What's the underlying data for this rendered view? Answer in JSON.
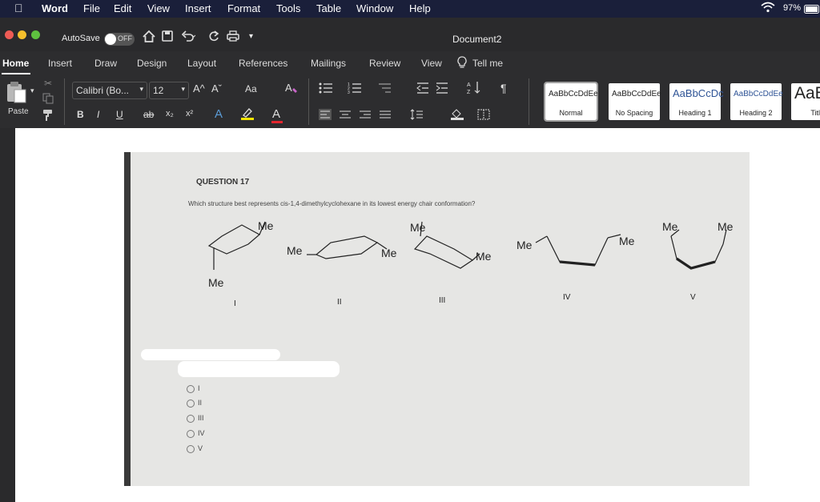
{
  "menubar": {
    "apple": "",
    "app_name": "Word",
    "items": [
      "File",
      "Edit",
      "View",
      "Insert",
      "Format",
      "Tools",
      "Table",
      "Window",
      "Help"
    ],
    "battery": "97%"
  },
  "window": {
    "autosave_label": "AutoSave",
    "autosave_state": "OFF",
    "title": "Document2"
  },
  "ribbon_tabs": [
    "Home",
    "Insert",
    "Draw",
    "Design",
    "Layout",
    "References",
    "Mailings",
    "Review",
    "View"
  ],
  "tell_me": "Tell me",
  "ribbon": {
    "paste": "Paste",
    "font_name": "Calibri (Bo...",
    "font_size": "12",
    "bold": "B",
    "italic": "I",
    "underline": "U",
    "strike": "ab",
    "subscript": "x₂",
    "superscript": "x²",
    "font_color_glyph": "A",
    "case_glyph": "Aa",
    "grow": "A^",
    "shrink": "Aˇ"
  },
  "styles": [
    {
      "preview": "AaBbCcDdEe",
      "name": "Normal",
      "color": "#222222"
    },
    {
      "preview": "AaBbCcDdEe",
      "name": "No Spacing",
      "color": "#222222"
    },
    {
      "preview": "AaBbCcDc",
      "name": "Heading 1",
      "color": "#2f5496"
    },
    {
      "preview": "AaBbCcDdEe",
      "name": "Heading 2",
      "color": "#2f5496"
    },
    {
      "preview": "AaE",
      "name": "Titl",
      "color": "#222222"
    }
  ],
  "document": {
    "question_title": "QUESTION 17",
    "question_text": "Which structure best represents cis-1,4-dimethylcyclohexane in its lowest energy chair conformation?",
    "structures": [
      {
        "numeral": "I",
        "labels": [
          "Me",
          "Me"
        ]
      },
      {
        "numeral": "II",
        "labels": [
          "Me",
          "Me"
        ]
      },
      {
        "numeral": "III",
        "labels": [
          "Me",
          "Me"
        ]
      },
      {
        "numeral": "IV",
        "labels": [
          "Me",
          "Me"
        ]
      },
      {
        "numeral": "V",
        "labels": [
          "Me",
          "Me"
        ]
      }
    ],
    "options": [
      "I",
      "II",
      "III",
      "IV",
      "V"
    ]
  }
}
